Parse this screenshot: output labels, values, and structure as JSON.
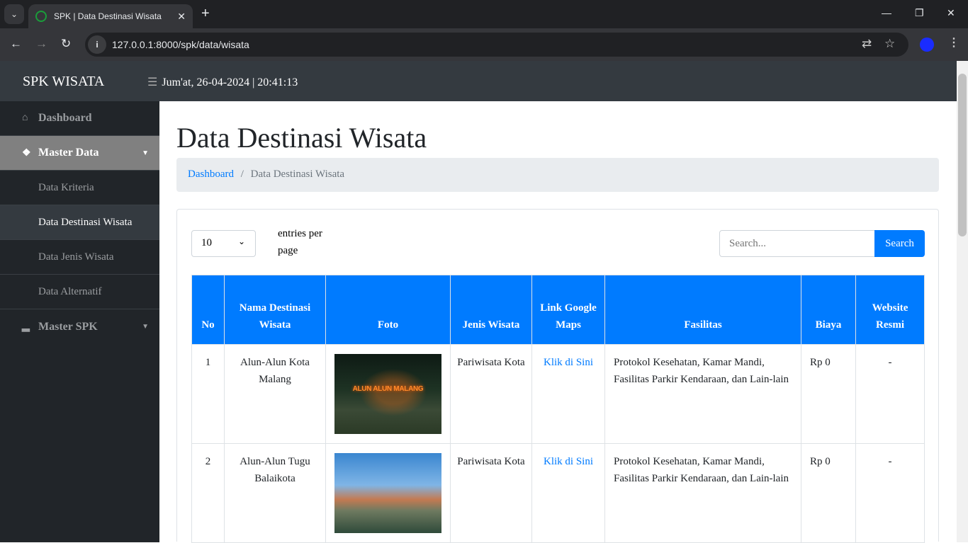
{
  "browser": {
    "tab_title": "SPK | Data Destinasi Wisata",
    "url": "127.0.0.1:8000/spk/data/wisata"
  },
  "header": {
    "brand": "SPK WISATA",
    "datetime": "Jum'at, 26-04-2024 | 20:41:13"
  },
  "sidebar": {
    "items": [
      {
        "label": "Dashboard",
        "icon": "home-icon"
      },
      {
        "label": "Master Data",
        "icon": "cubes-icon"
      },
      {
        "label": "Data Kriteria"
      },
      {
        "label": "Data Destinasi Wisata"
      },
      {
        "label": "Data Jenis Wisata"
      },
      {
        "label": "Data Alternatif"
      },
      {
        "label": "Master SPK",
        "icon": "podium-icon"
      }
    ]
  },
  "page": {
    "title": "Data Destinasi Wisata",
    "breadcrumb": [
      "Dashboard",
      "Data Destinasi Wisata"
    ]
  },
  "table_controls": {
    "per_page": "10",
    "per_page_label": "entries per page",
    "search_placeholder": "Search...",
    "search_button": "Search"
  },
  "table": {
    "headers": [
      "No",
      "Nama Destinasi Wisata",
      "Foto",
      "Jenis Wisata",
      "Link Google Maps",
      "Fasilitas",
      "Biaya",
      "Website Resmi"
    ],
    "rows": [
      {
        "no": "1",
        "nama": "Alun-Alun Kota Malang",
        "photo_text": "ALUN ALUN MALANG",
        "jenis": "Pariwisata Kota",
        "link": "Klik di Sini",
        "fasilitas": "Protokol Kesehatan, Kamar Mandi, Fasilitas Parkir Kendaraan, dan Lain-lain",
        "biaya": "Rp 0",
        "website": "-"
      },
      {
        "no": "2",
        "nama": "Alun-Alun Tugu Balaikota",
        "jenis": "Pariwisata Kota",
        "link": "Klik di Sini",
        "fasilitas": "Protokol Kesehatan, Kamar Mandi, Fasilitas Parkir Kendaraan, dan Lain-lain",
        "biaya": "Rp 0",
        "website": "-"
      }
    ]
  },
  "colors": {
    "primary": "#007bff",
    "sidebar": "#212529",
    "header": "#343a40"
  }
}
